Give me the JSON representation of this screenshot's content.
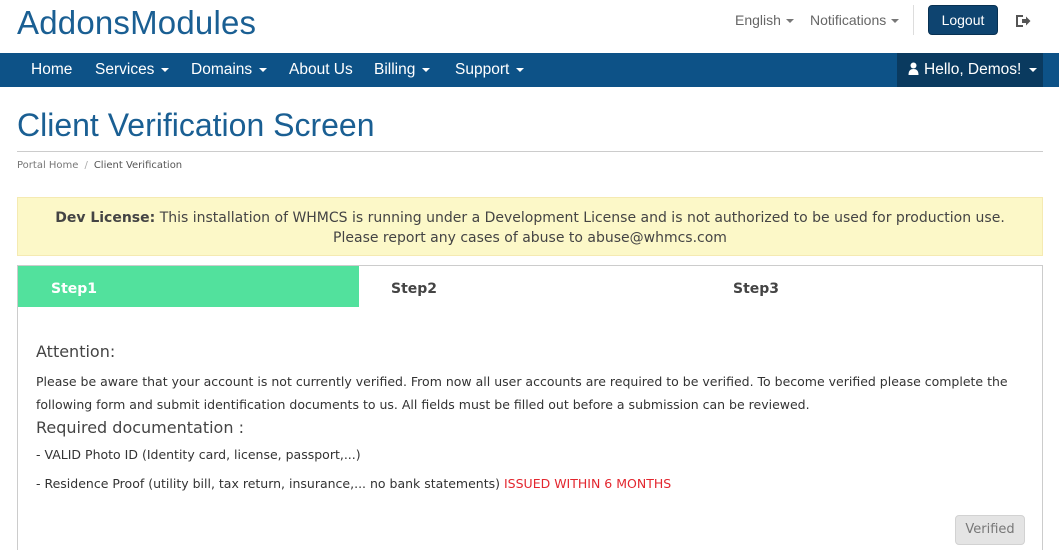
{
  "header": {
    "logo": "AddonsModules",
    "language_label": "English",
    "notifications_label": "Notifications",
    "logout_label": "Logout"
  },
  "nav": {
    "items": [
      {
        "label": "Home"
      },
      {
        "label": "Services"
      },
      {
        "label": "Domains"
      },
      {
        "label": "About Us"
      },
      {
        "label": "Billing"
      },
      {
        "label": "Support"
      }
    ],
    "user_label": "Hello, Demos!"
  },
  "page": {
    "title": "Client Verification Screen"
  },
  "breadcrumb": {
    "home": "Portal Home",
    "separator": "/",
    "current": "Client Verification"
  },
  "alert": {
    "label": "Dev License:",
    "text": "This installation of WHMCS is running under a Development License and is not authorized to be used for production use. Please report any cases of abuse to abuse@whmcs.com"
  },
  "steps": {
    "tabs": [
      {
        "label": "Step1",
        "active": true
      },
      {
        "label": "Step2",
        "active": false
      },
      {
        "label": "Step3",
        "active": false
      }
    ],
    "active_color": "#52e19d"
  },
  "verification": {
    "attention_heading": "Attention:",
    "attention_text": "Please be aware that your account is not currently verified. From now all user accounts are required to be verified. To become verified please complete the following form and submit identification documents to us. All fields must be filled out before a submission can be reviewed.",
    "required_heading": "Required documentation :",
    "item1": "- VALID Photo ID (Identity card, license, passport,...)",
    "item2_text": "- Residence Proof (utility bill, tax return, insurance,... no bank statements)",
    "item2_highlight": "ISSUED WITHIN 6 MONTHS",
    "verified_label": "Verified"
  },
  "colors": {
    "brand": "#1a5f93",
    "navbar": "#0d5287",
    "alert_bg": "#fcf8c8",
    "highlight_red": "#e3262e"
  },
  "icons": {
    "logout": "sign-out-icon",
    "user": "user-icon"
  }
}
